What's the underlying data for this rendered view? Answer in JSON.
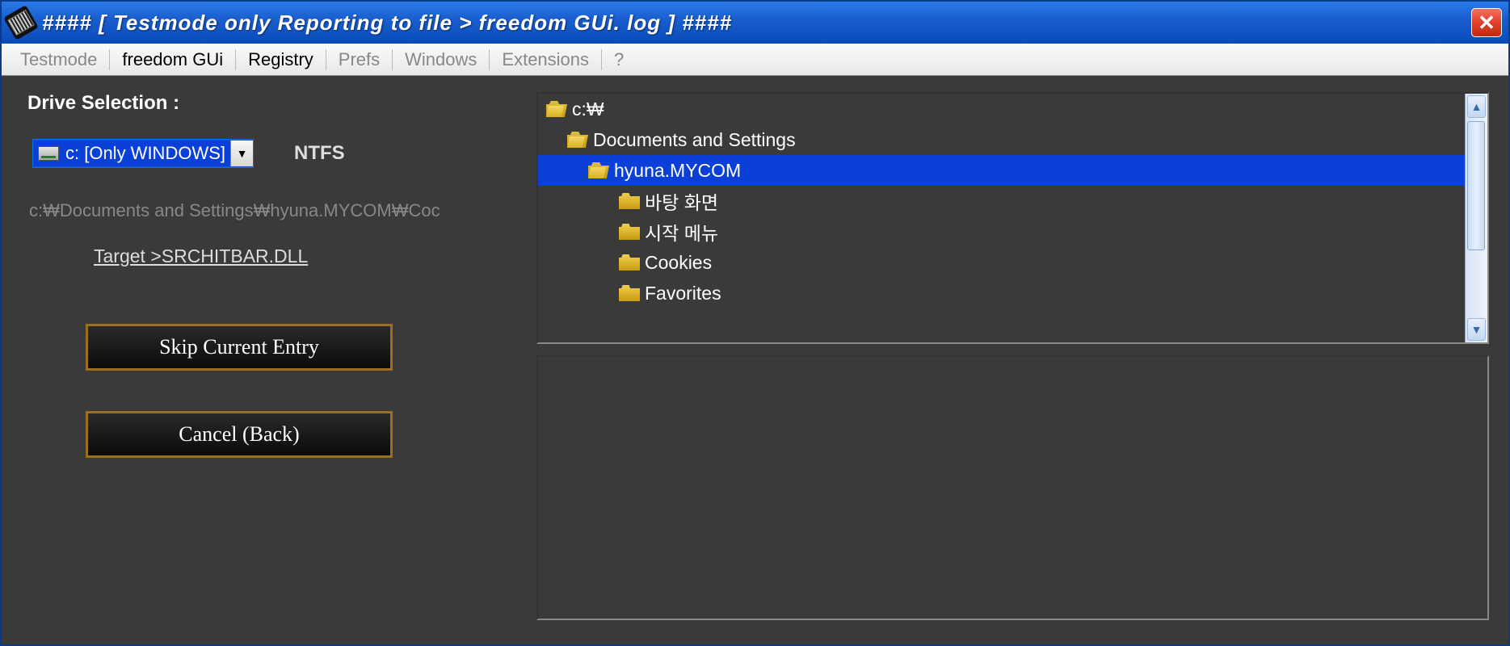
{
  "titlebar": {
    "title": "#### [ Testmode only Reporting to file > freedom GUi. log ] ####"
  },
  "menubar": {
    "items": [
      {
        "label": "Testmode",
        "active": false
      },
      {
        "label": "freedom GUi",
        "active": true
      },
      {
        "label": "Registry",
        "active": true
      },
      {
        "label": "Prefs",
        "active": false
      },
      {
        "label": "Windows",
        "active": false
      },
      {
        "label": "Extensions",
        "active": false
      },
      {
        "label": "?",
        "active": false
      }
    ]
  },
  "left": {
    "drive_selection_label": "Drive Selection :",
    "drive_value": "c: [Only WINDOWS]",
    "filesystem": "NTFS",
    "path": "c:₩Documents and Settings₩hyuna.MYCOM₩Coc",
    "target": "Target >SRCHITBAR.DLL",
    "skip_button": "Skip Current Entry",
    "cancel_button": "Cancel (Back)"
  },
  "tree": {
    "items": [
      {
        "label": "c:₩",
        "depth": 0,
        "open": true,
        "selected": false
      },
      {
        "label": "Documents and Settings",
        "depth": 1,
        "open": true,
        "selected": false
      },
      {
        "label": "hyuna.MYCOM",
        "depth": 2,
        "open": true,
        "selected": true
      },
      {
        "label": "바탕 화면",
        "depth": 3,
        "open": false,
        "selected": false
      },
      {
        "label": "시작 메뉴",
        "depth": 3,
        "open": false,
        "selected": false
      },
      {
        "label": "Cookies",
        "depth": 3,
        "open": false,
        "selected": false
      },
      {
        "label": "Favorites",
        "depth": 3,
        "open": false,
        "selected": false
      }
    ]
  }
}
